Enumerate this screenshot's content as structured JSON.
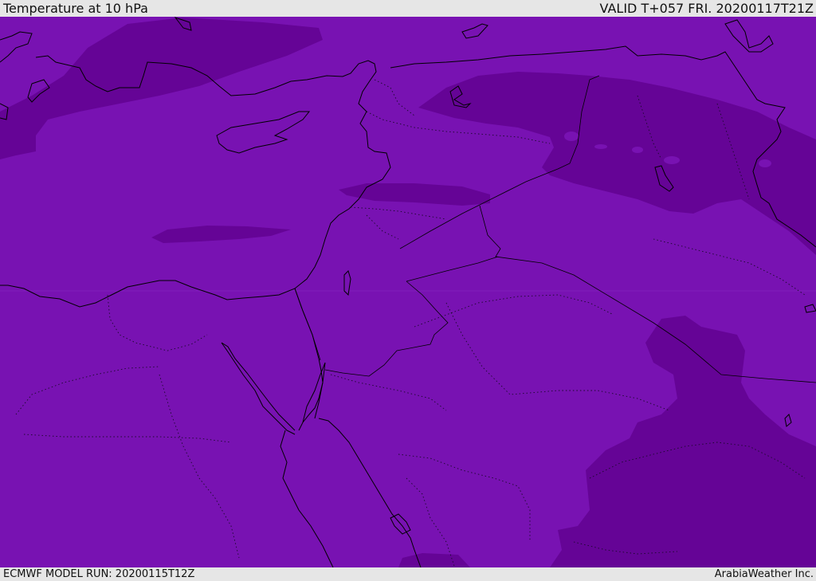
{
  "header": {
    "title": "Temperature at 10 hPa",
    "valid_time": "VALID T+057 FRI. 20200117T21Z"
  },
  "footer": {
    "model_run": "ECMWF MODEL RUN: 20200115T12Z",
    "credit": "ArabiaWeather Inc."
  },
  "colors": {
    "base_fill": "#7812b2",
    "cold_fill": "#650496",
    "coastline": "#000000",
    "bar_background": "#e6e6e6"
  }
}
